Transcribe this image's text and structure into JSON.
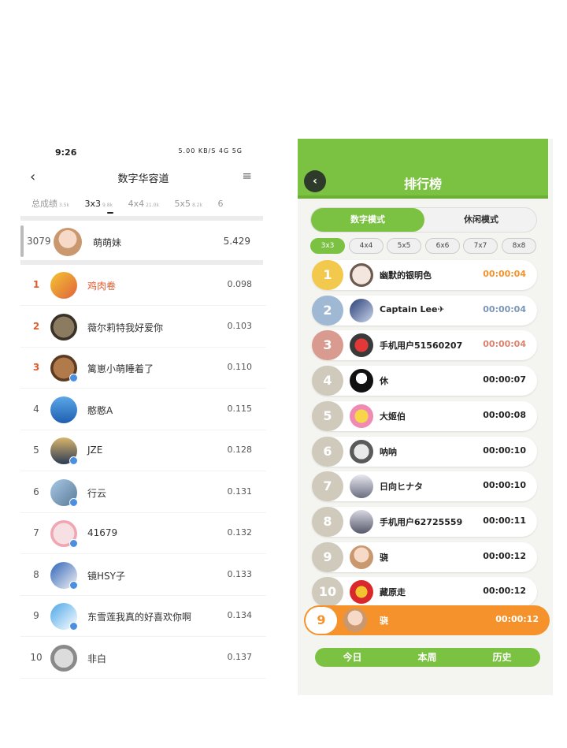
{
  "left": {
    "status": {
      "time": "9:26",
      "icons": "5.00 KB/S 4G 5G"
    },
    "header": {
      "back": "‹",
      "title": "数字华容道",
      "menu": "≡"
    },
    "tabs": [
      {
        "label": "总成绩",
        "count": "3.5k"
      },
      {
        "label": "3x3",
        "count": "9.8k"
      },
      {
        "label": "4x4",
        "count": "21.0k"
      },
      {
        "label": "5x5",
        "count": "8.2k"
      },
      {
        "label": "6",
        "count": ""
      }
    ],
    "active_tab": 1,
    "me": {
      "rank": "3079",
      "name": "萌萌妹",
      "score": "5.429"
    },
    "rows": [
      {
        "rank": "1",
        "name": "鸡肉卷",
        "score": "0.098"
      },
      {
        "rank": "2",
        "name": "薇尔莉特我好爱你",
        "score": "0.103"
      },
      {
        "rank": "3",
        "name": "篱崽小萌睡着了",
        "score": "0.110"
      },
      {
        "rank": "4",
        "name": "憨憨A",
        "score": "0.115"
      },
      {
        "rank": "5",
        "name": "JZE",
        "score": "0.128"
      },
      {
        "rank": "6",
        "name": "行云",
        "score": "0.131"
      },
      {
        "rank": "7",
        "name": "41679",
        "score": "0.132"
      },
      {
        "rank": "8",
        "name": "镜HSY子",
        "score": "0.133"
      },
      {
        "rank": "9",
        "name": "东雪莲我真的好喜欢你啊",
        "score": "0.134"
      },
      {
        "rank": "10",
        "name": "非白",
        "score": "0.137"
      }
    ]
  },
  "right": {
    "title": "排行榜",
    "modes": [
      "数字模式",
      "休闲模式"
    ],
    "sizes": [
      "3x3",
      "4x4",
      "5x5",
      "6x6",
      "7x7",
      "8x8"
    ],
    "rows": [
      {
        "rank": "1",
        "name": "幽默的银明色",
        "time": "00:00:04"
      },
      {
        "rank": "2",
        "name": "Captain  Lee✈",
        "time": "00:00:04"
      },
      {
        "rank": "3",
        "name": "手机用户51560207",
        "time": "00:00:04"
      },
      {
        "rank": "4",
        "name": "休",
        "time": "00:00:07"
      },
      {
        "rank": "5",
        "name": "大姬伯",
        "time": "00:00:08"
      },
      {
        "rank": "6",
        "name": "呐呐",
        "time": "00:00:10"
      },
      {
        "rank": "7",
        "name": "日向ヒナタ",
        "time": "00:00:10"
      },
      {
        "rank": "8",
        "name": "手机用户62725559",
        "time": "00:00:11"
      },
      {
        "rank": "9",
        "name": "骁",
        "time": "00:00:12"
      },
      {
        "rank": "10",
        "name": "藏原走",
        "time": "00:00:12"
      }
    ],
    "me": {
      "rank": "9",
      "name": "骁",
      "time": "00:00:12"
    },
    "bottom_tabs": [
      "今日",
      "本周",
      "历史"
    ]
  },
  "colors": {
    "green": "#7cc242",
    "orange": "#f5922b",
    "gold": "#f2c94c",
    "silver": "#9fb8d4",
    "bronze": "#d99a8f",
    "top_rank_red": "#e35a2c"
  }
}
